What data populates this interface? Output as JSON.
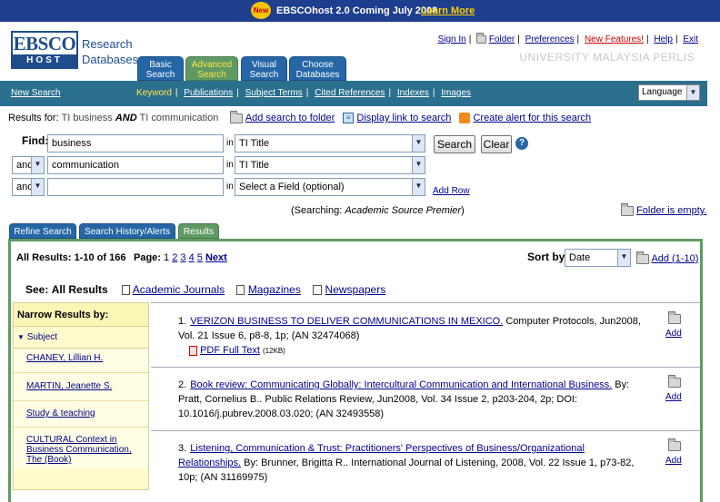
{
  "banner": {
    "badge": "New",
    "text": "EBSCOhost 2.0   Coming July 2008",
    "link": "Learn More"
  },
  "logo": {
    "top": "EBSCO",
    "bottom": "HOST",
    "text_line1": "Research",
    "text_line2": "Databases"
  },
  "main_tabs": [
    {
      "line1": "Basic",
      "line2": "Search"
    },
    {
      "line1": "Advanced",
      "line2": "Search"
    },
    {
      "line1": "Visual",
      "line2": "Search"
    },
    {
      "line1": "Choose",
      "line2": "Databases"
    }
  ],
  "top_links": {
    "sign_in": "Sign In",
    "folder": "Folder",
    "preferences": "Preferences",
    "new_features": "New Features!",
    "help": "Help",
    "exit": "Exit"
  },
  "institution": "UNIVERSITY MALAYSIA PERLIS",
  "navbar": {
    "new_search": "New Search",
    "keyword": "Keyword",
    "items": [
      "Publications",
      "Subject Terms",
      "Cited References",
      "Indexes",
      "Images"
    ]
  },
  "language": {
    "selected": "Language"
  },
  "results_for": {
    "label": "Results for:",
    "query_pre": "TI business",
    "query_op": "AND",
    "query_post": "TI communication",
    "add_search": "Add search to folder",
    "display_link": "Display link to search",
    "create_alert": "Create alert for this search"
  },
  "search": {
    "find_label": "Find:",
    "rows": [
      {
        "op": "",
        "value": "business",
        "in": "in",
        "field": "TI Title"
      },
      {
        "op": "and",
        "value": "communication",
        "in": "in",
        "field": "TI Title"
      },
      {
        "op": "and",
        "value": "",
        "in": "in",
        "field": "Select a Field (optional)"
      }
    ],
    "search_btn": "Search",
    "clear_btn": "Clear",
    "help_icon": "?",
    "add_row": "Add Row",
    "searching_pre": "(Searching: ",
    "searching_db": "Academic Source Premier",
    "searching_post": ")",
    "folder_status": "Folder is empty."
  },
  "result_tabs": [
    "Refine Search",
    "Search History/Alerts",
    "Results"
  ],
  "results": {
    "summary": "All Results: 1-10 of 166",
    "page_label": "Page:",
    "pages": [
      "1",
      "2",
      "3",
      "4",
      "5"
    ],
    "next": "Next",
    "sort_label": "Sort by:",
    "sort_value": "Date",
    "add_range": "Add (1-10)",
    "see_label": "See:",
    "see_all": "All Results",
    "filters": [
      "Academic Journals",
      "Magazines",
      "Newspapers"
    ]
  },
  "narrow": {
    "header": "Narrow Results by:",
    "subject": "Subject",
    "facets": [
      "CHANEY, Lillian H.",
      "MARTIN, Jeanette S.",
      "Study & teaching",
      "CULTURAL Context in Business Communication, The (Book)"
    ]
  },
  "items": [
    {
      "num": "1.",
      "title": "VERIZON BUSINESS TO DELIVER COMMUNICATIONS IN MEXICO.",
      "rest": " Computer Protocols, Jun2008, Vol. 21 Issue 6, p8-8, 1p; (AN 32474068)",
      "pdf": "PDF Full Text",
      "pdf_size": "(12KB)",
      "add": "Add"
    },
    {
      "num": "2.",
      "title": "Book review: Communicating Globally: Intercultural Communication and International Business.",
      "rest": " By: Pratt, Cornelius B.. Public Relations Review, Jun2008, Vol. 34 Issue 2, p203-204, 2p; DOI: 10.1016/j.pubrev.2008.03.020; (AN 32493558)",
      "add": "Add"
    },
    {
      "num": "3.",
      "title": "Listening, Communication & Trust: Practitioners' Perspectives of Business/Organizational Relationships.",
      "rest": " By: Brunner, Brigitta R.. International Journal of Listening, 2008, Vol. 22 Issue 1, p73-82, 10p; (AN 31169975)",
      "add": "Add"
    }
  ]
}
